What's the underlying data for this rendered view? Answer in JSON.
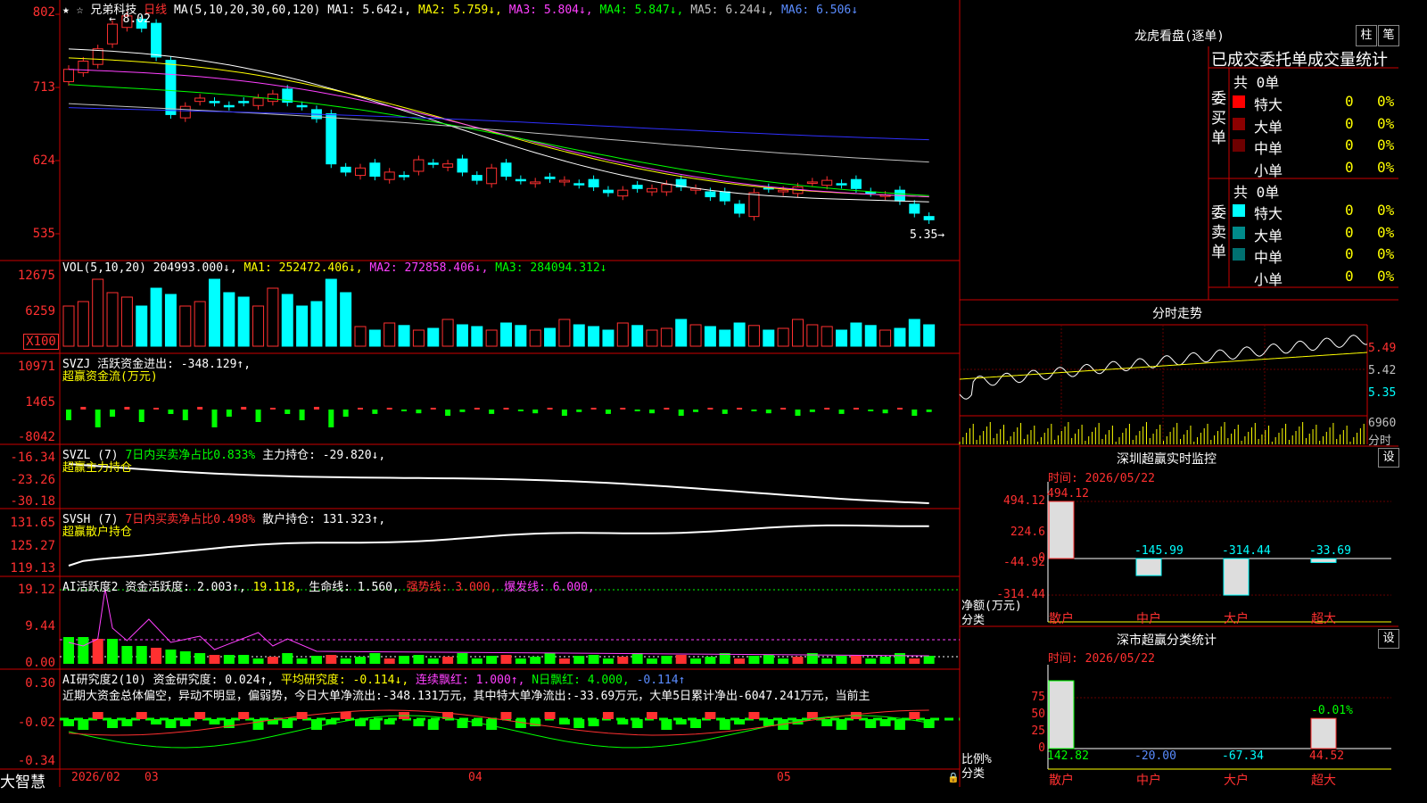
{
  "header": {
    "stock_name": "兄弟科技",
    "period": "日线",
    "ma_params": "MA(5,10,20,30,60,120)",
    "ma1": "MA1: 5.642↓,",
    "ma2": "MA2: 5.759↓,",
    "ma3": "MA3: 5.804↓,",
    "ma4": "MA4: 5.847↓,",
    "ma5": "MA5: 6.244↓,",
    "ma6": "MA6: 6.506↓",
    "high_label": "← 8.02",
    "low_label": "5.35→",
    "axis": [
      "802",
      "713",
      "624",
      "535"
    ]
  },
  "vol": {
    "title": "VOL(5,10,20)",
    "value": "204993.000↓,",
    "ma1": "MA1: 252472.406↓,",
    "ma2": "MA2: 272858.406↓,",
    "ma3": "MA3: 284094.312↓",
    "axis": [
      "12675",
      "6259",
      "X100"
    ]
  },
  "svzj": {
    "title": "SVZJ  活跃资金进出: -348.129↑,",
    "subtitle": "超赢资金流(万元)",
    "axis": [
      "10971",
      "1465",
      "-8042"
    ]
  },
  "svzl": {
    "title_a": "SVZL (7)",
    "title_b": "7日内买卖净占比0.833%",
    "title_c": "主力持仓: -29.820↓,",
    "subtitle": "超赢主力持仓",
    "axis": [
      "-16.34",
      "-23.26",
      "-30.18"
    ]
  },
  "svsh": {
    "title_a": "SVSH (7)",
    "title_b": "7日内买卖净占比0.498%",
    "title_c": "散户持仓: 131.323↑,",
    "subtitle": "超赢散户持仓",
    "axis": [
      "131.65",
      "125.27",
      "119.13"
    ]
  },
  "ai": {
    "title_a": "AI活跃度2 资金活跃度: 2.003↑,",
    "title_b": "19.118,",
    "title_c": "生命线: 1.560,",
    "title_d": "强势线: 3.000,",
    "title_e": "爆发线: 6.000,",
    "axis": [
      "19.12",
      "9.44",
      "0.00"
    ]
  },
  "research": {
    "title_a": "AI研究度2(10) 资金研究度: 0.024↑,",
    "title_b": "平均研究度: -0.114↓,",
    "title_c": "连续飘红: 1.000↑,",
    "title_d": "N日飘红: 4.000,",
    "title_e": "-0.114↑",
    "summary": "近期大资金总体偏空，异动不明显，偏弱势，今日大单净流出:-348.131万元，其中特大单净流出:-33.69万元，大单5日累计净出-6047.241万元，当前主",
    "axis": [
      "0.30",
      "-0.02",
      "-0.34"
    ]
  },
  "footer": {
    "brand": "大智慧",
    "dates": [
      "2026/02",
      "03",
      "04",
      "05"
    ]
  },
  "dragon": {
    "title": "龙虎看盘(逐单)",
    "btn_a": "柱",
    "btn_b": "笔",
    "tabs": "已成交委托单成交量统计",
    "buy_label": "委买单",
    "sell_label": "委卖单",
    "buy_total": "共 0单",
    "sell_total": "共 0单",
    "buy_rows": [
      {
        "label": "特大",
        "n": "0",
        "p": "0%"
      },
      {
        "label": "大单",
        "n": "0",
        "p": "0%"
      },
      {
        "label": "中单",
        "n": "0",
        "p": "0%"
      },
      {
        "label": "小单",
        "n": "0",
        "p": "0%"
      }
    ],
    "sell_rows": [
      {
        "label": "特大",
        "n": "0",
        "p": "0%"
      },
      {
        "label": "大单",
        "n": "0",
        "p": "0%"
      },
      {
        "label": "中单",
        "n": "0",
        "p": "0%"
      },
      {
        "label": "小单",
        "n": "0",
        "p": "0%"
      }
    ]
  },
  "intraday": {
    "title": "分时走势",
    "axis": [
      "5.49",
      "5.42",
      "5.35"
    ],
    "vol_top": "6960",
    "vol_unit": "分时"
  },
  "monitor": {
    "title": "深圳超赢实时监控",
    "btn": "设",
    "time": "时间: 2026/05/22",
    "axis": [
      "494.12",
      "224.6",
      "0",
      "-44.92",
      "-314.44"
    ],
    "ylabel_a": "净额(万元)",
    "ylabel_b": "分类",
    "categories": [
      "散户",
      "中户",
      "大户",
      "超大"
    ],
    "value_labels": [
      "494.12",
      "-145.99",
      "-314.44",
      "-33.69"
    ]
  },
  "classify": {
    "title": "深市超赢分类统计",
    "btn": "设",
    "time": "时间: 2026/05/22",
    "axis": [
      "75",
      "50",
      "25",
      "0"
    ],
    "ylabel_a": "比例%",
    "ylabel_b": "分类",
    "categories": [
      "散户",
      "中户",
      "大户",
      "超大"
    ],
    "value_labels": [
      "142.82",
      "-20.00",
      "-67.34",
      "44.52"
    ],
    "extra_label": "-0.01%"
  },
  "chart_data": [
    {
      "type": "bar",
      "title": "深圳超赢实时监控",
      "ylabel": "净额(万元)",
      "categories": [
        "散户",
        "中户",
        "大户",
        "超大"
      ],
      "values": [
        494.12,
        -145.99,
        -314.44,
        -33.69
      ],
      "ylim": [
        -314.44,
        494.12
      ]
    },
    {
      "type": "bar",
      "title": "深市超赢分类统计",
      "ylabel": "比例%",
      "categories": [
        "散户",
        "中户",
        "大户",
        "超大"
      ],
      "values": [
        142.82,
        -20.0,
        -67.34,
        44.52
      ],
      "ylim": [
        0,
        75
      ]
    },
    {
      "type": "line",
      "title": "日线",
      "series_names": [
        "MA1",
        "MA2",
        "MA3",
        "MA4",
        "MA5",
        "MA6"
      ],
      "latest": [
        5.642,
        5.759,
        5.804,
        5.847,
        6.244,
        6.506
      ],
      "ylim": [
        5.35,
        8.02
      ]
    }
  ],
  "colors": {
    "frame": "#cc0000",
    "up": "#ff3030",
    "down": "#00ffff",
    "ma1": "#ffffff",
    "ma2": "#ffff00",
    "ma3": "#ff40ff",
    "ma4": "#00ff00",
    "ma5": "#c0c0c0",
    "ma6": "#3030ff"
  }
}
